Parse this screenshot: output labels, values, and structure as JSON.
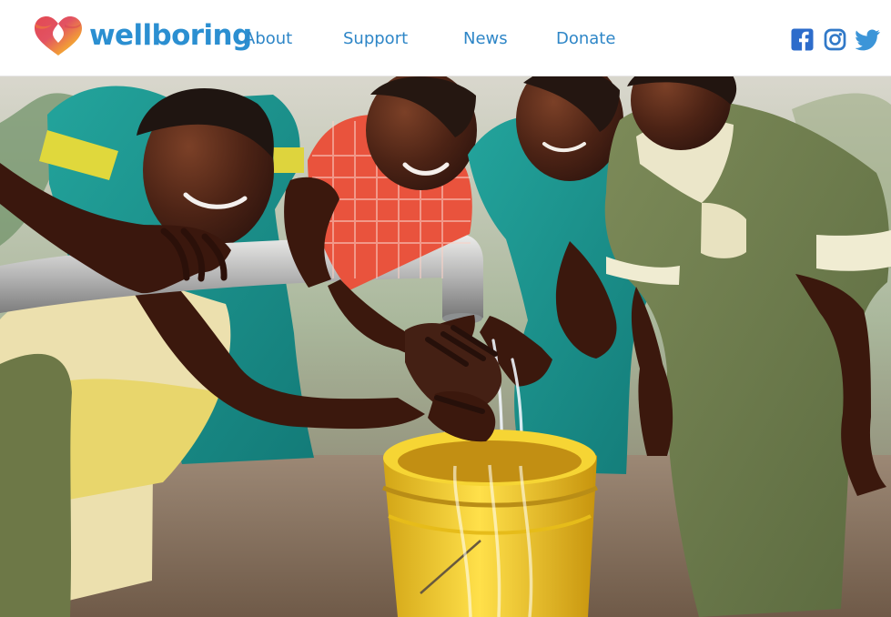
{
  "brand": {
    "name": "wellboring",
    "logo_icon": "heart-water-drop-icon",
    "colors": {
      "brand_blue": "#2b8fd1",
      "heart_red": "#dc3b48",
      "heart_orange": "#f19a38",
      "heart_yellow": "#f5cd39"
    }
  },
  "nav": {
    "items": [
      {
        "label": "About"
      },
      {
        "label": "Support"
      },
      {
        "label": "News"
      },
      {
        "label": "Donate"
      }
    ]
  },
  "social": [
    {
      "icon": "facebook-icon",
      "color": "#2d6ccb"
    },
    {
      "icon": "instagram-icon",
      "color": "#3179c8"
    },
    {
      "icon": "twitter-icon",
      "color": "#3c95d8"
    }
  ],
  "hero": {
    "description_icon": "children-washing-hands-photo"
  }
}
